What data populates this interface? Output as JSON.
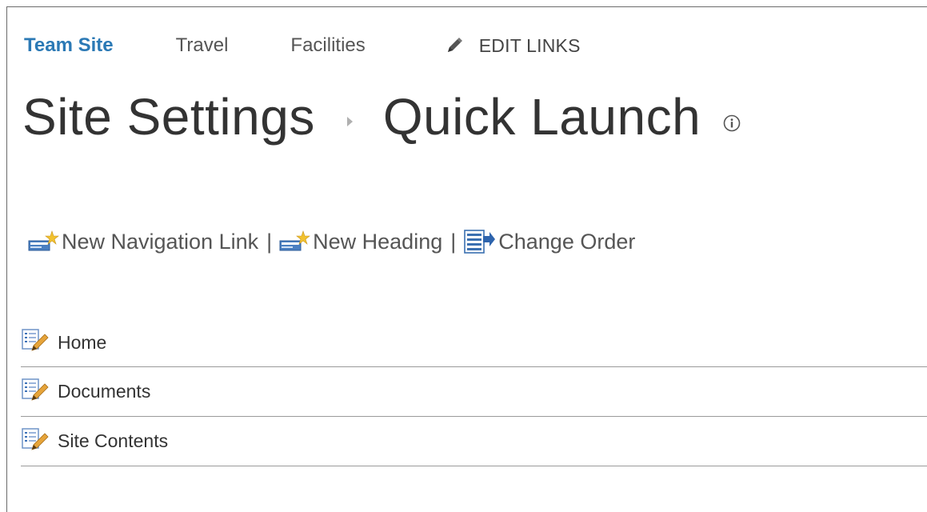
{
  "top_nav": {
    "items": [
      {
        "label": "Team Site",
        "active": true
      },
      {
        "label": "Travel",
        "active": false
      },
      {
        "label": "Facilities",
        "active": false
      }
    ],
    "edit_links_label": "EDIT LINKS",
    "edit_links_icon": "pencil-icon"
  },
  "title": {
    "parent": "Site Settings",
    "current": "Quick Launch",
    "info_icon": "info-icon"
  },
  "toolbar": {
    "new_link": "New Navigation Link",
    "new_heading": "New Heading",
    "change_order": "Change Order",
    "separator": "|"
  },
  "nav_items": [
    {
      "label": "Home",
      "icon": "edit-item-icon"
    },
    {
      "label": "Documents",
      "icon": "edit-item-icon"
    },
    {
      "label": "Site Contents",
      "icon": "edit-item-icon"
    }
  ],
  "colors": {
    "accent": "#2b79b5",
    "text": "#444444",
    "divider": "#9a9a9a"
  }
}
